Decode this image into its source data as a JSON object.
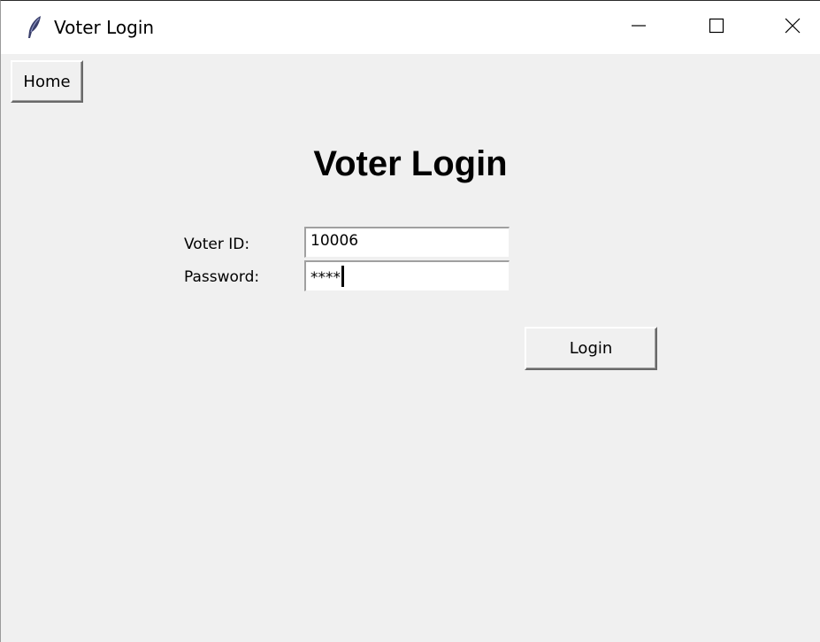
{
  "window": {
    "title": "Voter Login",
    "controls": {
      "minimize_icon": "minimize-icon",
      "maximize_icon": "maximize-icon",
      "close_icon": "close-icon"
    },
    "app_icon": "feather-icon"
  },
  "toolbar": {
    "home_label": "Home"
  },
  "form": {
    "heading": "Voter Login",
    "voter_id_label": "Voter ID:",
    "voter_id_value": "10006",
    "password_label": "Password:",
    "password_value": "****",
    "login_label": "Login"
  },
  "colors": {
    "window_bg": "#f0f0f0",
    "titlebar_bg": "#ffffff",
    "field_bg": "#ffffff"
  }
}
